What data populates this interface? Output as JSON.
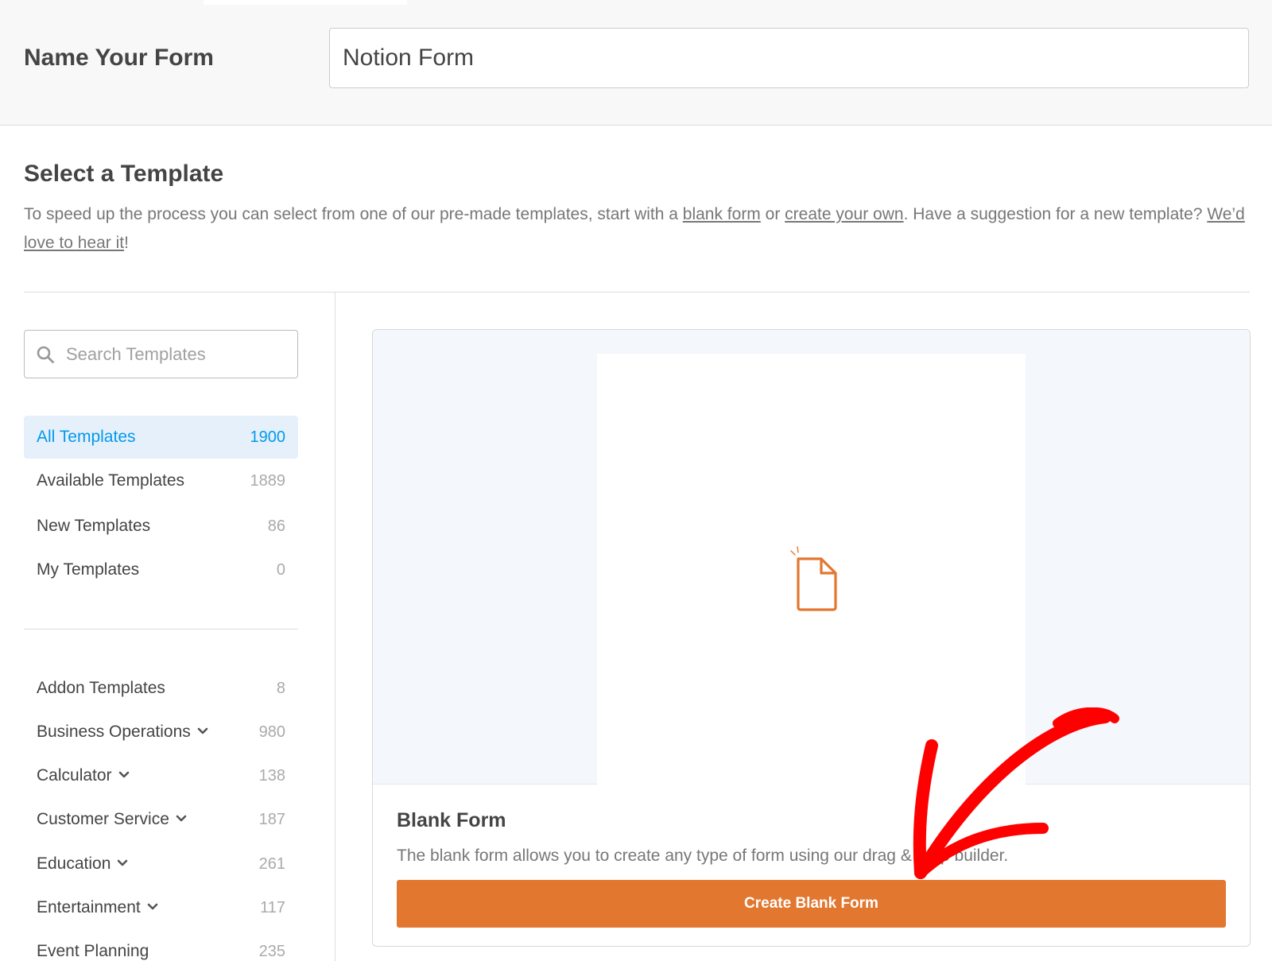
{
  "form_name": {
    "label": "Name Your Form",
    "value": "Notion Form"
  },
  "template_section": {
    "title": "Select a Template",
    "desc_part1": "To speed up the process you can select from one of our pre-made templates, start with a ",
    "blank_form_link": "blank form",
    "desc_part2": " or ",
    "create_link": "create your own",
    "desc_part3": ". Have a suggestion for a new template? ",
    "suggest_link": "We’d love to hear it",
    "desc_part4": "!"
  },
  "search": {
    "placeholder": "Search Templates",
    "icon": "search-icon"
  },
  "categories_main": [
    {
      "label": "All Templates",
      "count": "1900",
      "active": true
    },
    {
      "label": "Available Templates",
      "count": "1889"
    },
    {
      "label": "New Templates",
      "count": "86"
    },
    {
      "label": "My Templates",
      "count": "0"
    }
  ],
  "categories_more": [
    {
      "label": "Addon Templates",
      "count": "8"
    },
    {
      "label": "Business Operations",
      "count": "980",
      "expandable": true
    },
    {
      "label": "Calculator",
      "count": "138",
      "expandable": true
    },
    {
      "label": "Customer Service",
      "count": "187",
      "expandable": true
    },
    {
      "label": "Education",
      "count": "261",
      "expandable": true
    },
    {
      "label": "Entertainment",
      "count": "117",
      "expandable": true
    },
    {
      "label": "Event Planning",
      "count": "235"
    }
  ],
  "blank_card": {
    "title": "Blank Form",
    "description": "The blank form allows you to create any type of form using our drag & drop builder.",
    "button_label": "Create Blank Form",
    "icon": "blank-document-icon"
  },
  "colors": {
    "accent": "#0399ed",
    "button": "#e27730",
    "annotation": "#ff0000"
  }
}
